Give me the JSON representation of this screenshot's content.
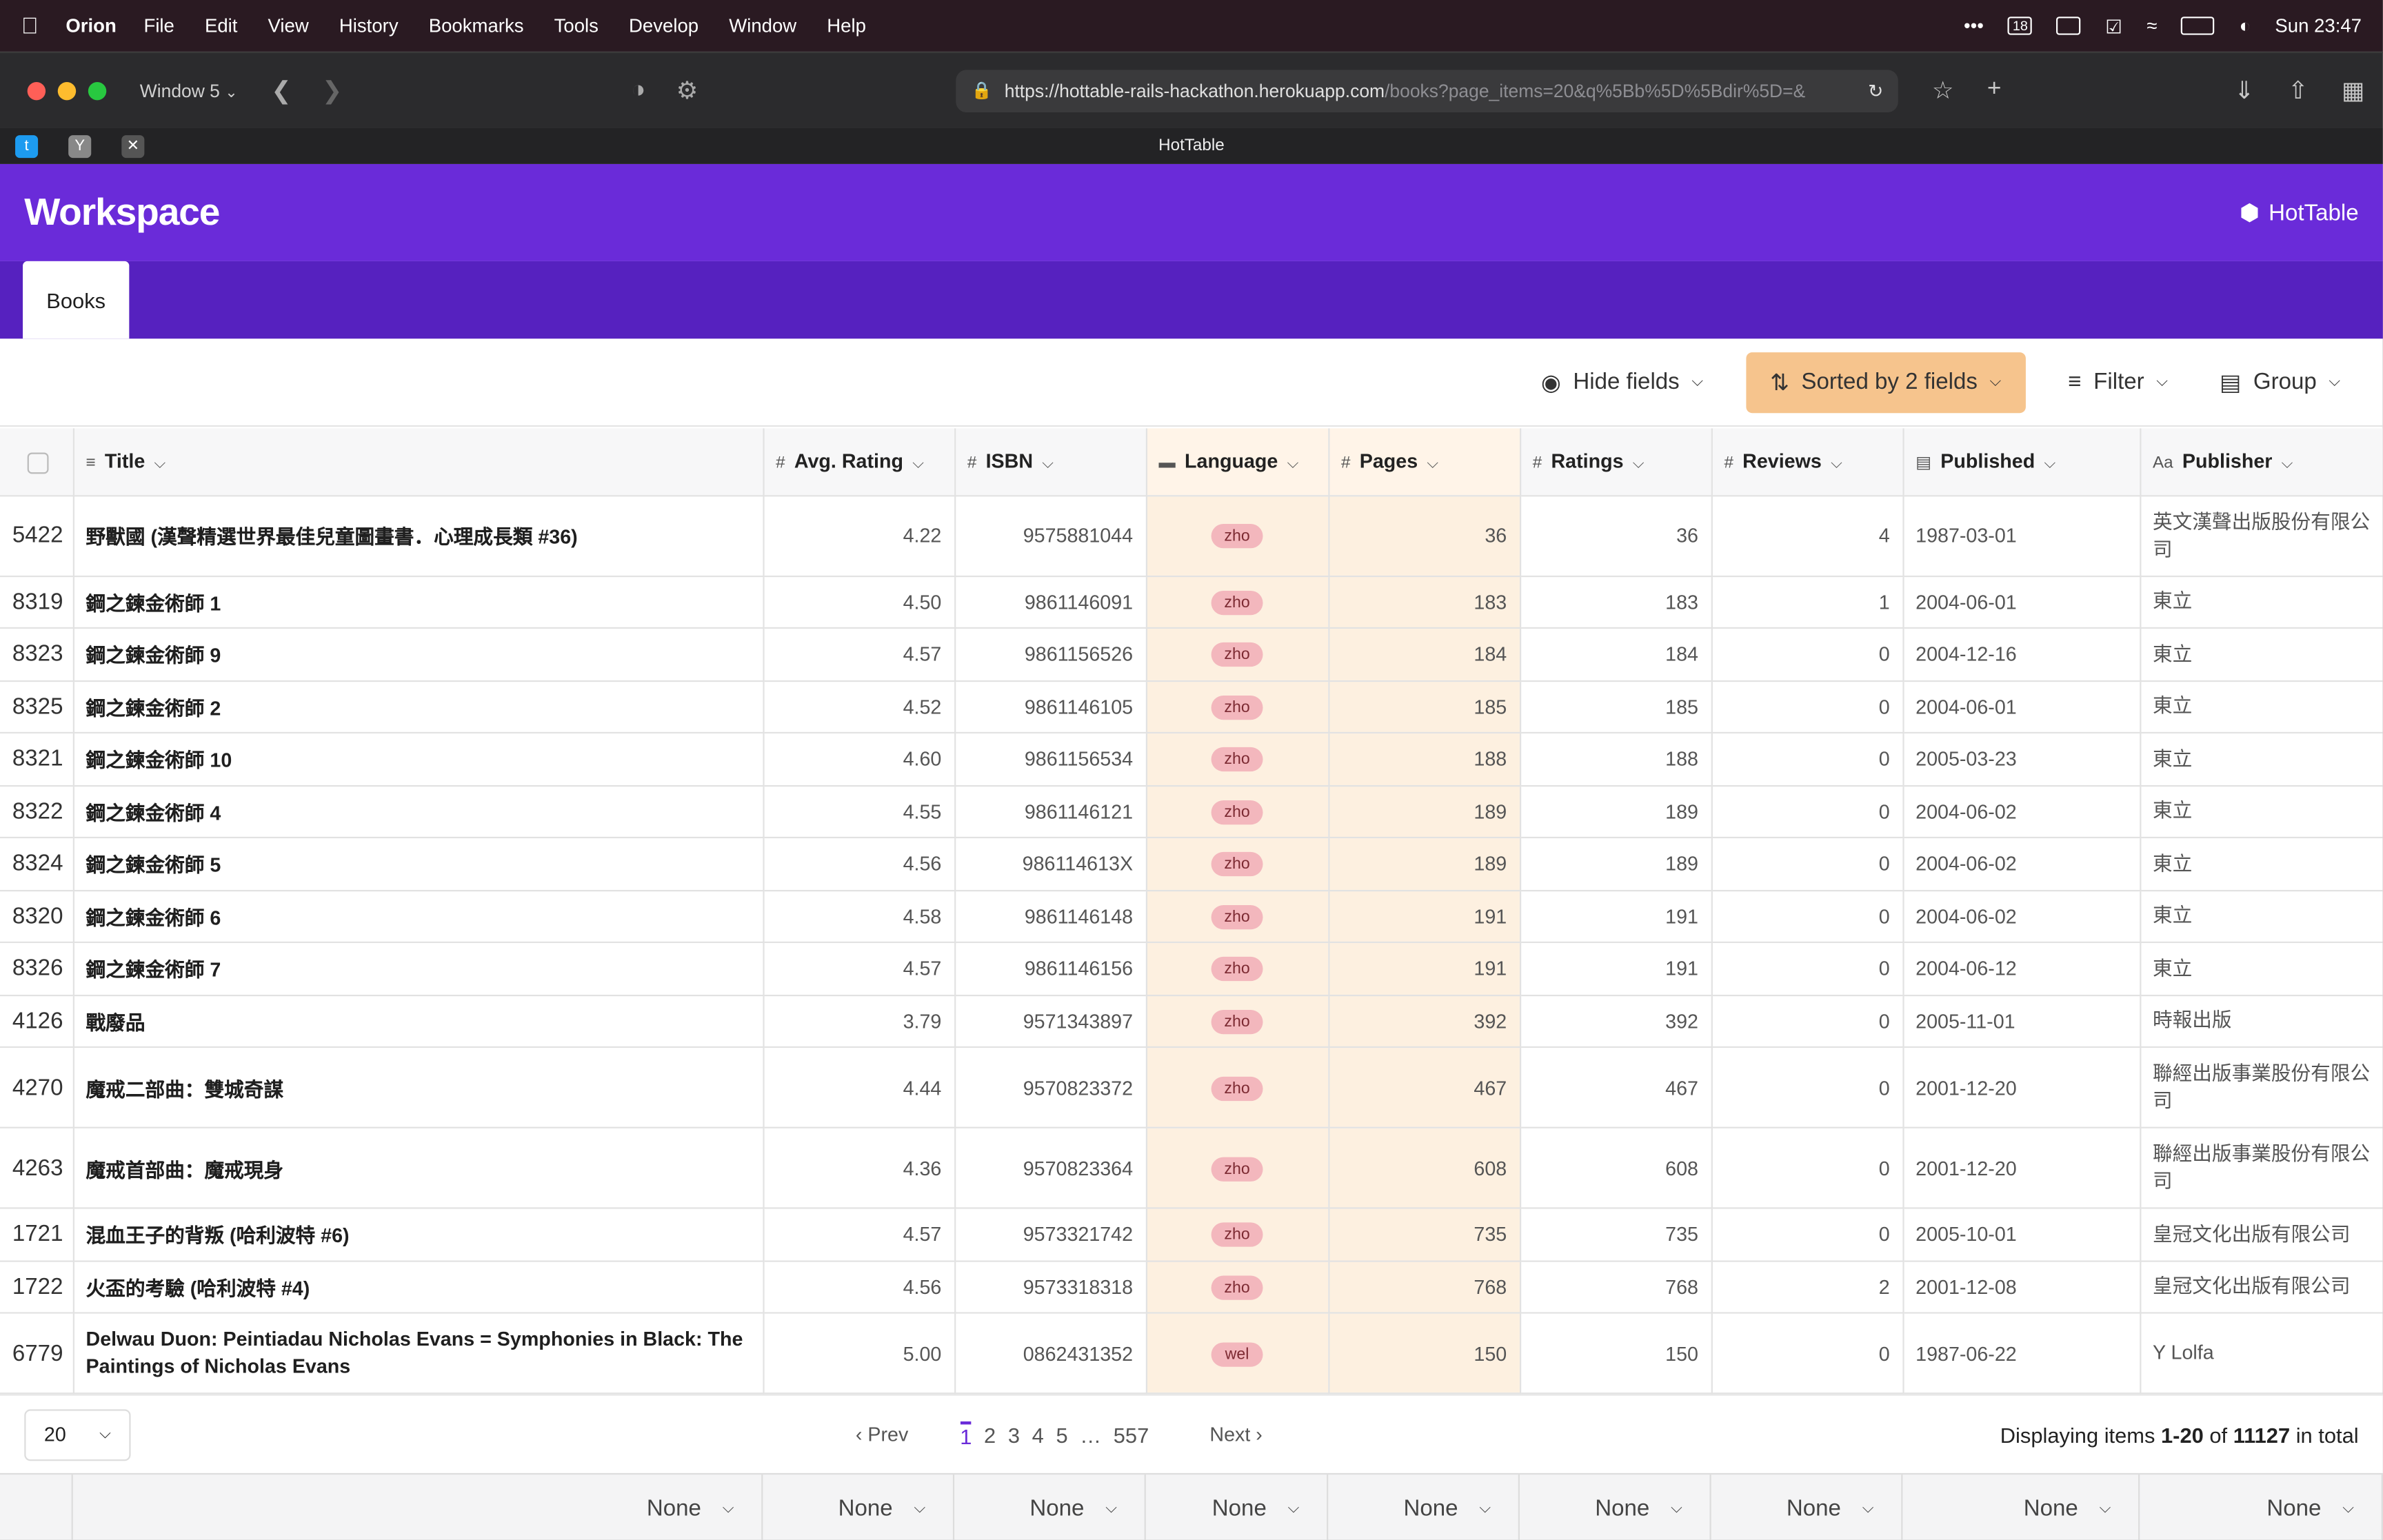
{
  "menubar": {
    "app": "Orion",
    "items": [
      "File",
      "Edit",
      "View",
      "History",
      "Bookmarks",
      "Tools",
      "Develop",
      "Window",
      "Help"
    ],
    "clock": "Sun 23:47",
    "date_icon": "18"
  },
  "browser": {
    "window_name": "Window 5",
    "url_host": "https://hottable-rails-hackathon.herokuapp.com",
    "url_path": "/books?page_items=20&q%5Bb%5D%5Bdir%5D=&",
    "tab_title": "HotTable"
  },
  "app": {
    "workspace": "Workspace",
    "brand": "HotTable",
    "tab": "Books",
    "accent": "#6a2bd9"
  },
  "toolbar": {
    "hide_fields": "Hide fields",
    "sorted": "Sorted by 2 fields",
    "filter": "Filter",
    "group": "Group"
  },
  "columns": [
    "Title",
    "Avg. Rating",
    "ISBN",
    "Language",
    "Pages",
    "Ratings",
    "Reviews",
    "Published",
    "Publisher"
  ],
  "rows": [
    {
      "id": "5422",
      "title": "野獸國 (漢聲精選世界最佳兒童圖畫書．心理成長類 #36)",
      "rating": "4.22",
      "isbn": "9575881044",
      "lang": "zho",
      "pages": "36",
      "ratings": "36",
      "reviews": "4",
      "published": "1987-03-01",
      "publisher": "英文漢聲出版股份有限公司"
    },
    {
      "id": "8319",
      "title": "鋼之鍊金術師 1",
      "rating": "4.50",
      "isbn": "9861146091",
      "lang": "zho",
      "pages": "183",
      "ratings": "183",
      "reviews": "1",
      "published": "2004-06-01",
      "publisher": "東立"
    },
    {
      "id": "8323",
      "title": "鋼之鍊金術師 9",
      "rating": "4.57",
      "isbn": "9861156526",
      "lang": "zho",
      "pages": "184",
      "ratings": "184",
      "reviews": "0",
      "published": "2004-12-16",
      "publisher": "東立"
    },
    {
      "id": "8325",
      "title": "鋼之鍊金術師 2",
      "rating": "4.52",
      "isbn": "9861146105",
      "lang": "zho",
      "pages": "185",
      "ratings": "185",
      "reviews": "0",
      "published": "2004-06-01",
      "publisher": "東立"
    },
    {
      "id": "8321",
      "title": "鋼之鍊金術師 10",
      "rating": "4.60",
      "isbn": "9861156534",
      "lang": "zho",
      "pages": "188",
      "ratings": "188",
      "reviews": "0",
      "published": "2005-03-23",
      "publisher": "東立"
    },
    {
      "id": "8322",
      "title": "鋼之鍊金術師 4",
      "rating": "4.55",
      "isbn": "9861146121",
      "lang": "zho",
      "pages": "189",
      "ratings": "189",
      "reviews": "0",
      "published": "2004-06-02",
      "publisher": "東立"
    },
    {
      "id": "8324",
      "title": "鋼之鍊金術師 5",
      "rating": "4.56",
      "isbn": "986114613X",
      "lang": "zho",
      "pages": "189",
      "ratings": "189",
      "reviews": "0",
      "published": "2004-06-02",
      "publisher": "東立"
    },
    {
      "id": "8320",
      "title": "鋼之鍊金術師 6",
      "rating": "4.58",
      "isbn": "9861146148",
      "lang": "zho",
      "pages": "191",
      "ratings": "191",
      "reviews": "0",
      "published": "2004-06-02",
      "publisher": "東立"
    },
    {
      "id": "8326",
      "title": "鋼之鍊金術師 7",
      "rating": "4.57",
      "isbn": "9861146156",
      "lang": "zho",
      "pages": "191",
      "ratings": "191",
      "reviews": "0",
      "published": "2004-06-12",
      "publisher": "東立"
    },
    {
      "id": "4126",
      "title": "戰廢品",
      "rating": "3.79",
      "isbn": "9571343897",
      "lang": "zho",
      "pages": "392",
      "ratings": "392",
      "reviews": "0",
      "published": "2005-11-01",
      "publisher": "時報出版"
    },
    {
      "id": "4270",
      "title": "魔戒二部曲：雙城奇謀",
      "rating": "4.44",
      "isbn": "9570823372",
      "lang": "zho",
      "pages": "467",
      "ratings": "467",
      "reviews": "0",
      "published": "2001-12-20",
      "publisher": "聯經出版事業股份有限公司"
    },
    {
      "id": "4263",
      "title": "魔戒首部曲：魔戒現身",
      "rating": "4.36",
      "isbn": "9570823364",
      "lang": "zho",
      "pages": "608",
      "ratings": "608",
      "reviews": "0",
      "published": "2001-12-20",
      "publisher": "聯經出版事業股份有限公司"
    },
    {
      "id": "1721",
      "title": "混血王子的背叛 (哈利波特 #6)",
      "rating": "4.57",
      "isbn": "9573321742",
      "lang": "zho",
      "pages": "735",
      "ratings": "735",
      "reviews": "0",
      "published": "2005-10-01",
      "publisher": "皇冠文化出版有限公司"
    },
    {
      "id": "1722",
      "title": "火盃的考驗 (哈利波特 #4)",
      "rating": "4.56",
      "isbn": "9573318318",
      "lang": "zho",
      "pages": "768",
      "ratings": "768",
      "reviews": "2",
      "published": "2001-12-08",
      "publisher": "皇冠文化出版有限公司"
    },
    {
      "id": "6779",
      "title": "Delwau Duon: Peintiadau Nicholas Evans = Symphonies in Black: The Paintings of Nicholas Evans",
      "rating": "5.00",
      "isbn": "0862431352",
      "lang": "wel",
      "pages": "150",
      "ratings": "150",
      "reviews": "0",
      "published": "1987-06-22",
      "publisher": "Y Lolfa"
    }
  ],
  "pager": {
    "per_page": "20",
    "prev": "‹ Prev",
    "next": "Next ›",
    "pages": [
      "1",
      "2",
      "3",
      "4",
      "5"
    ],
    "ellipsis": "…",
    "last": "557",
    "display_pre": "Displaying items ",
    "display_range": "1-20",
    "display_mid": " of ",
    "display_total": "11127",
    "display_post": " in total"
  },
  "aggregate": {
    "label": "None"
  }
}
